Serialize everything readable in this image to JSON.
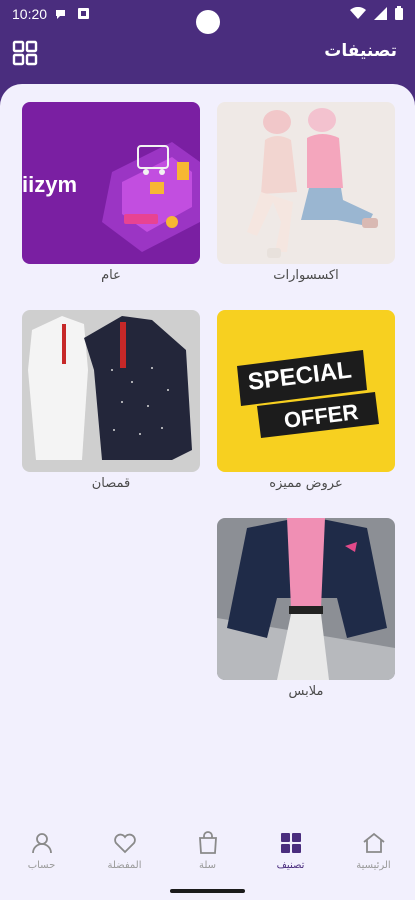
{
  "status": {
    "time": "10:20"
  },
  "appbar": {
    "title": "تصنيفات"
  },
  "categories": [
    {
      "label": "اكسسوارات",
      "image": "women-fashion-photo"
    },
    {
      "label": "عام",
      "image": "iizym-shopping-banner",
      "brand": "iizym"
    },
    {
      "label": "عروض مميزه",
      "image": "special-offer-banner",
      "banner_line1": "SPECIAL",
      "banner_line2": "OFFER"
    },
    {
      "label": "قمصان",
      "image": "shirts-photo"
    },
    {
      "label": "ملابس",
      "image": "men-suit-photo"
    }
  ],
  "nav": [
    {
      "label": "الرئيسية",
      "icon": "home-icon",
      "active": false
    },
    {
      "label": "تصنيف",
      "icon": "category-icon",
      "active": true
    },
    {
      "label": "سلة",
      "icon": "bag-icon",
      "active": false
    },
    {
      "label": "المفضلة",
      "icon": "heart-icon",
      "active": false
    },
    {
      "label": "حساب",
      "icon": "account-icon",
      "active": false
    }
  ],
  "colors": {
    "primary": "#4a2d7e",
    "background": "#f2f0fd",
    "offer_yellow": "#f7d020",
    "iizym_purple": "#7a1fa2"
  }
}
